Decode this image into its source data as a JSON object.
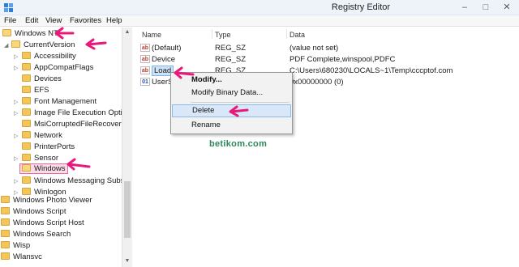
{
  "window": {
    "title": "Registry Editor",
    "minimize": "–",
    "maximize": "□",
    "close": "✕"
  },
  "menu": [
    "File",
    "Edit",
    "View",
    "Favorites",
    "Help"
  ],
  "tree": [
    "Windows NT",
    "CurrentVersion",
    "Accessibility",
    "AppCompatFlags",
    "Devices",
    "EFS",
    "Font Management",
    "Image File Execution Optio",
    "MsiCorruptedFileRecovery",
    "Network",
    "PrinterPorts",
    "Sensor",
    "Windows",
    "Windows Messaging Subsy",
    "Winlogon",
    "Windows Photo Viewer",
    "Windows Script",
    "Windows Script Host",
    "Windows Search",
    "Wisp",
    "Wlansvc"
  ],
  "columns": {
    "name": "Name",
    "type": "Type",
    "data": "Data"
  },
  "rows": [
    {
      "name": "(Default)",
      "type": "REG_SZ",
      "data": "(value not set)"
    },
    {
      "name": "Device",
      "type": "REG_SZ",
      "data": "PDF Complete,winspool,PDFC"
    },
    {
      "name": "Load",
      "type": "REG_SZ",
      "data": "C:\\Users\\680230\\LOCALS~1\\Temp\\cccptof.com"
    },
    {
      "name": "UserS",
      "type": "",
      "data": "0x00000000 (0)"
    }
  ],
  "context_menu": {
    "modify": "Modify...",
    "modify_binary": "Modify Binary Data...",
    "delete": "Delete",
    "rename": "Rename"
  },
  "watermark": "betikom.com",
  "colors": {
    "annotation_arrow": "#e8197a",
    "selection_box": "#e56b9e"
  }
}
